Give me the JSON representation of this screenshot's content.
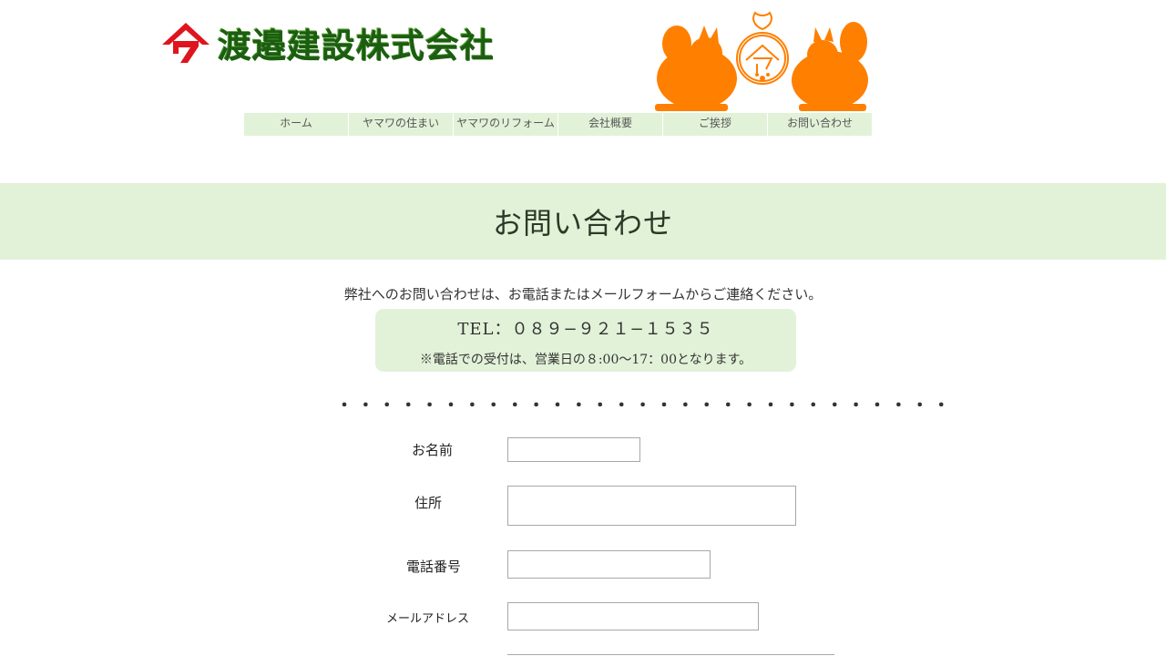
{
  "header": {
    "company_name": "渡邉建設株式会社",
    "logo_mark_color": "#e0141e",
    "emblem_color": "#ff7f00"
  },
  "nav": {
    "items": [
      {
        "label": "ホーム"
      },
      {
        "label": "ヤマワの住まい"
      },
      {
        "label": "ヤマワのリフォーム"
      },
      {
        "label": "会社概要"
      },
      {
        "label": "ご挨拶"
      },
      {
        "label": "お問い合わせ"
      }
    ],
    "background": "#e2f2d8"
  },
  "page": {
    "title": "お問い合わせ",
    "intro": "弊社へのお問い合わせは、お電話またはメールフォームからご連絡ください。",
    "tel": "TEL：０８９−９２１−１５３５",
    "tel_note": "※電話での受付は、営業日の８:00〜17：00となります。",
    "divider": "・・・・・・・・・・・・・・・・・・・・・・・・・・・・・"
  },
  "form": {
    "name_label": "お名前",
    "address_label": "住所",
    "phone_label": "電話番号",
    "email_label": "メールアドレス",
    "name_value": "",
    "address_value": "",
    "phone_value": "",
    "email_value": ""
  }
}
